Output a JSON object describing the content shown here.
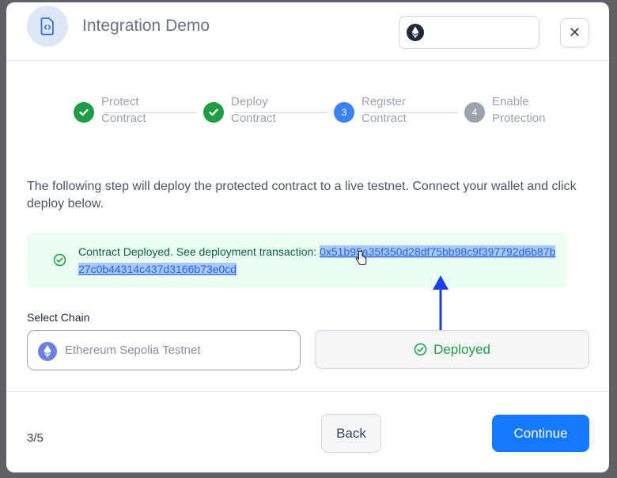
{
  "header": {
    "title": "Integration Demo",
    "app_icon": "document-code-icon",
    "chain_icon": "ethereum-icon",
    "close_icon": "close-icon"
  },
  "stepper": {
    "steps": [
      {
        "label": "Protect Contract",
        "state": "done",
        "marker": ""
      },
      {
        "label": "Deploy Contract",
        "state": "done",
        "marker": ""
      },
      {
        "label": "Register Contract",
        "state": "current",
        "marker": "3"
      },
      {
        "label": "Enable Protection",
        "state": "pending",
        "marker": "4"
      }
    ]
  },
  "main": {
    "intro": "The following step will deploy the protected contract to a live testnet. Connect your wallet and click deploy below.",
    "alert": {
      "text": "Contract Deployed. See deployment transaction: ",
      "tx_hash": "0x51b95a35f350d28df75bb98c9f397792d6b87b27c0b44314c437d3166b73e0cd"
    },
    "select_chain_label": "Select Chain",
    "chain_value": "Ethereum Sepolia Testnet",
    "deployed_label": "Deployed"
  },
  "footer": {
    "progress": "3/5",
    "back_label": "Back",
    "continue_label": "Continue"
  },
  "colors": {
    "success": "#1f9d45",
    "primary": "#1677ff",
    "current_step": "#3b82f6",
    "annotation_arrow": "#1a3ee8"
  }
}
